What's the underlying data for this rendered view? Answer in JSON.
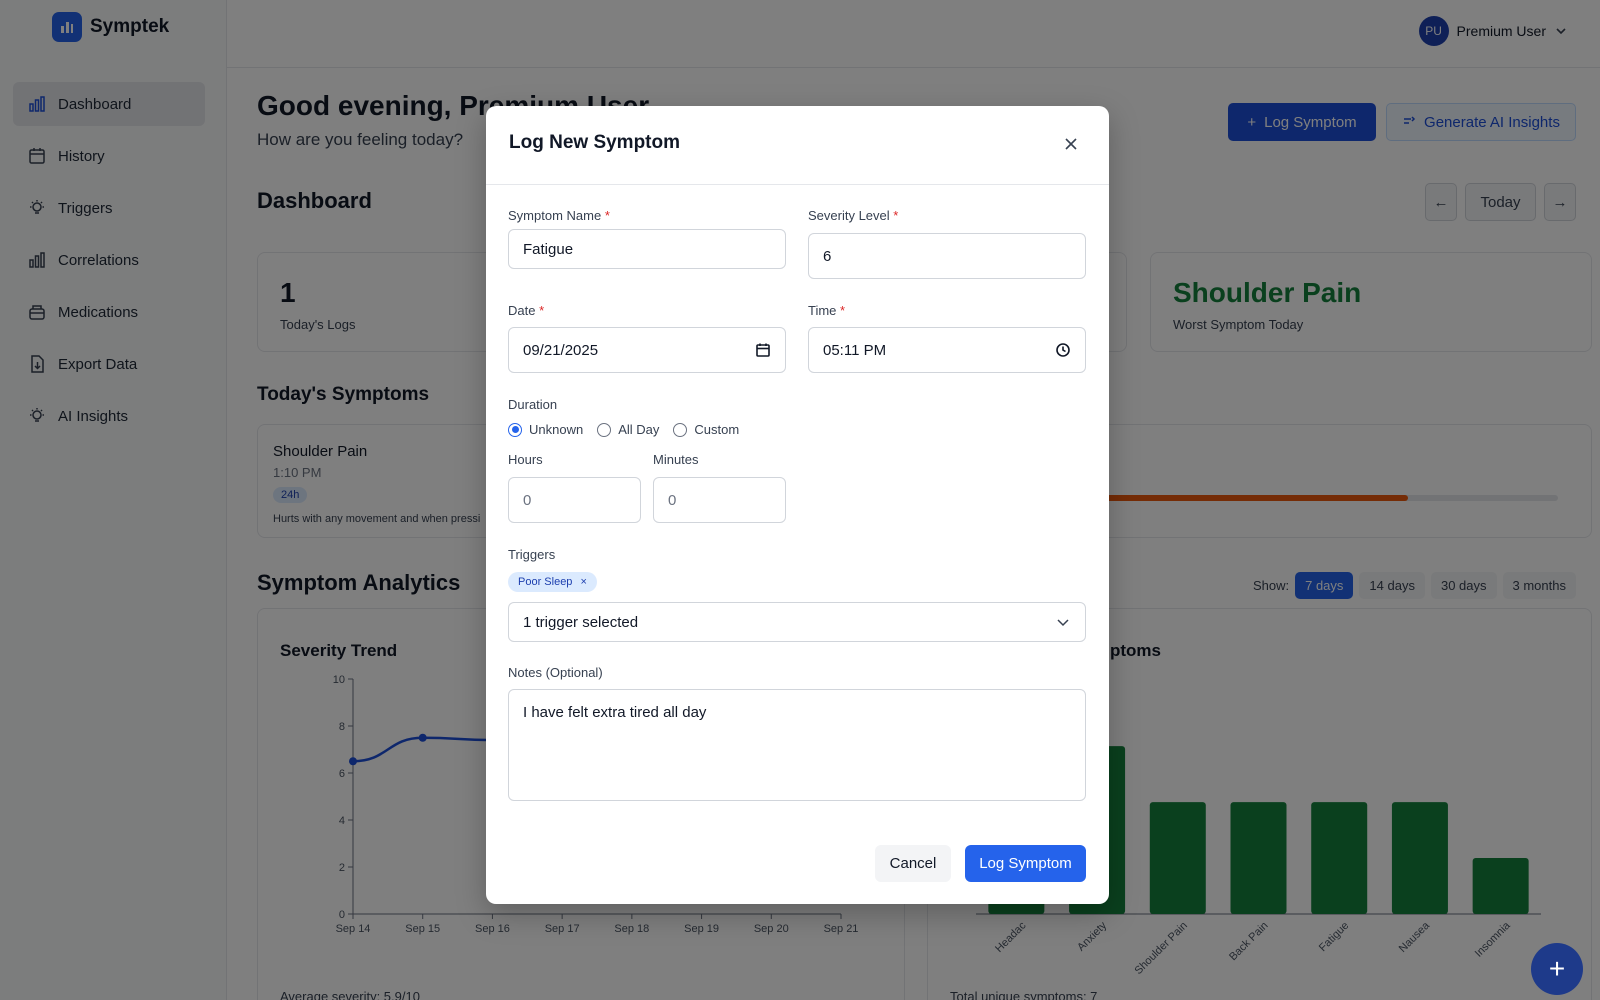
{
  "app": {
    "name": "Symptek"
  },
  "sidebar": {
    "items": [
      {
        "label": "Dashboard",
        "icon": "bar-chart-icon"
      },
      {
        "label": "History",
        "icon": "calendar-icon"
      },
      {
        "label": "Triggers",
        "icon": "lightbulb-icon"
      },
      {
        "label": "Correlations",
        "icon": "bar-chart-icon"
      },
      {
        "label": "Medications",
        "icon": "pill-box-icon"
      },
      {
        "label": "Export Data",
        "icon": "file-download-icon"
      },
      {
        "label": "AI Insights",
        "icon": "lightbulb-icon"
      }
    ]
  },
  "user": {
    "initials": "PU",
    "name": "Premium User"
  },
  "header": {
    "greeting": "Good evening, Premium User",
    "subtitle": "How are you feeling today?",
    "log_symptom": "Log Symptom",
    "generate_insights": "Generate AI Insights"
  },
  "dashboard": {
    "title": "Dashboard",
    "prev": "←",
    "today": "Today",
    "next": "→",
    "stats": {
      "logs_value": "1",
      "logs_label": "Today's Logs",
      "worst_value": "Shoulder Pain",
      "worst_label": "Worst Symptom Today"
    },
    "todays_symptoms_title": "Today's Symptoms",
    "symptom": {
      "name": "Shoulder Pain",
      "time": "1:10 PM",
      "badge": "24h",
      "note": "Hurts with any movement and when pressi",
      "severity_fraction": 0.7
    },
    "analytics_title": "Symptom Analytics",
    "show_label": "Show:",
    "ranges": [
      "7 days",
      "14 days",
      "30 days",
      "3 months"
    ],
    "severity_card": {
      "title": "Severity Trend",
      "footer": "Average severity: 5.9/10"
    },
    "symptoms_card": {
      "title_fragment": "ptoms",
      "footer": "Total unique symptoms: 7"
    }
  },
  "chart_data": [
    {
      "type": "line",
      "title": "Severity Trend",
      "x": [
        "Sep 14",
        "Sep 15",
        "Sep 16",
        "Sep 17",
        "Sep 18",
        "Sep 19",
        "Sep 20",
        "Sep 21"
      ],
      "y_visible": [
        6.5,
        7.5,
        7.4
      ],
      "ylim": [
        0,
        10
      ],
      "yticks": [
        0,
        2,
        4,
        6,
        8,
        10
      ],
      "color": "#1d4ed8"
    },
    {
      "type": "bar",
      "categories": [
        "Headache",
        "Anxiety",
        "Shoulder Pain",
        "Back Pain",
        "Fatigue",
        "Nausea",
        "Insomnia"
      ],
      "category_labels_visible": [
        "Headac",
        "Anxiety",
        "Shoulder Pain",
        "Back Pain",
        "Fatigue",
        "Nausea",
        "Insomnia"
      ],
      "values": [
        3,
        3,
        2,
        2,
        2,
        2,
        1
      ],
      "color": "#15803d"
    }
  ],
  "modal": {
    "title": "Log New Symptom",
    "symptom_name_label": "Symptom Name",
    "symptom_name_value": "Fatigue",
    "severity_label": "Severity Level",
    "severity_value": "6",
    "date_label": "Date",
    "date_value": "09/21/2025",
    "time_label": "Time",
    "time_value": "05:11 PM",
    "duration_label": "Duration",
    "duration_options": [
      "Unknown",
      "All Day",
      "Custom"
    ],
    "duration_selected": "Unknown",
    "hours_label": "Hours",
    "hours_value": "0",
    "minutes_label": "Minutes",
    "minutes_value": "0",
    "triggers_label": "Triggers",
    "trigger_chip": "Poor Sleep",
    "trigger_chip_remove": "×",
    "triggers_select": "1 trigger selected",
    "notes_label": "Notes (Optional)",
    "notes_value": "I have felt extra tired all day",
    "required_mark": "*",
    "cancel": "Cancel",
    "submit": "Log Symptom"
  },
  "fab": {
    "label": "+"
  }
}
